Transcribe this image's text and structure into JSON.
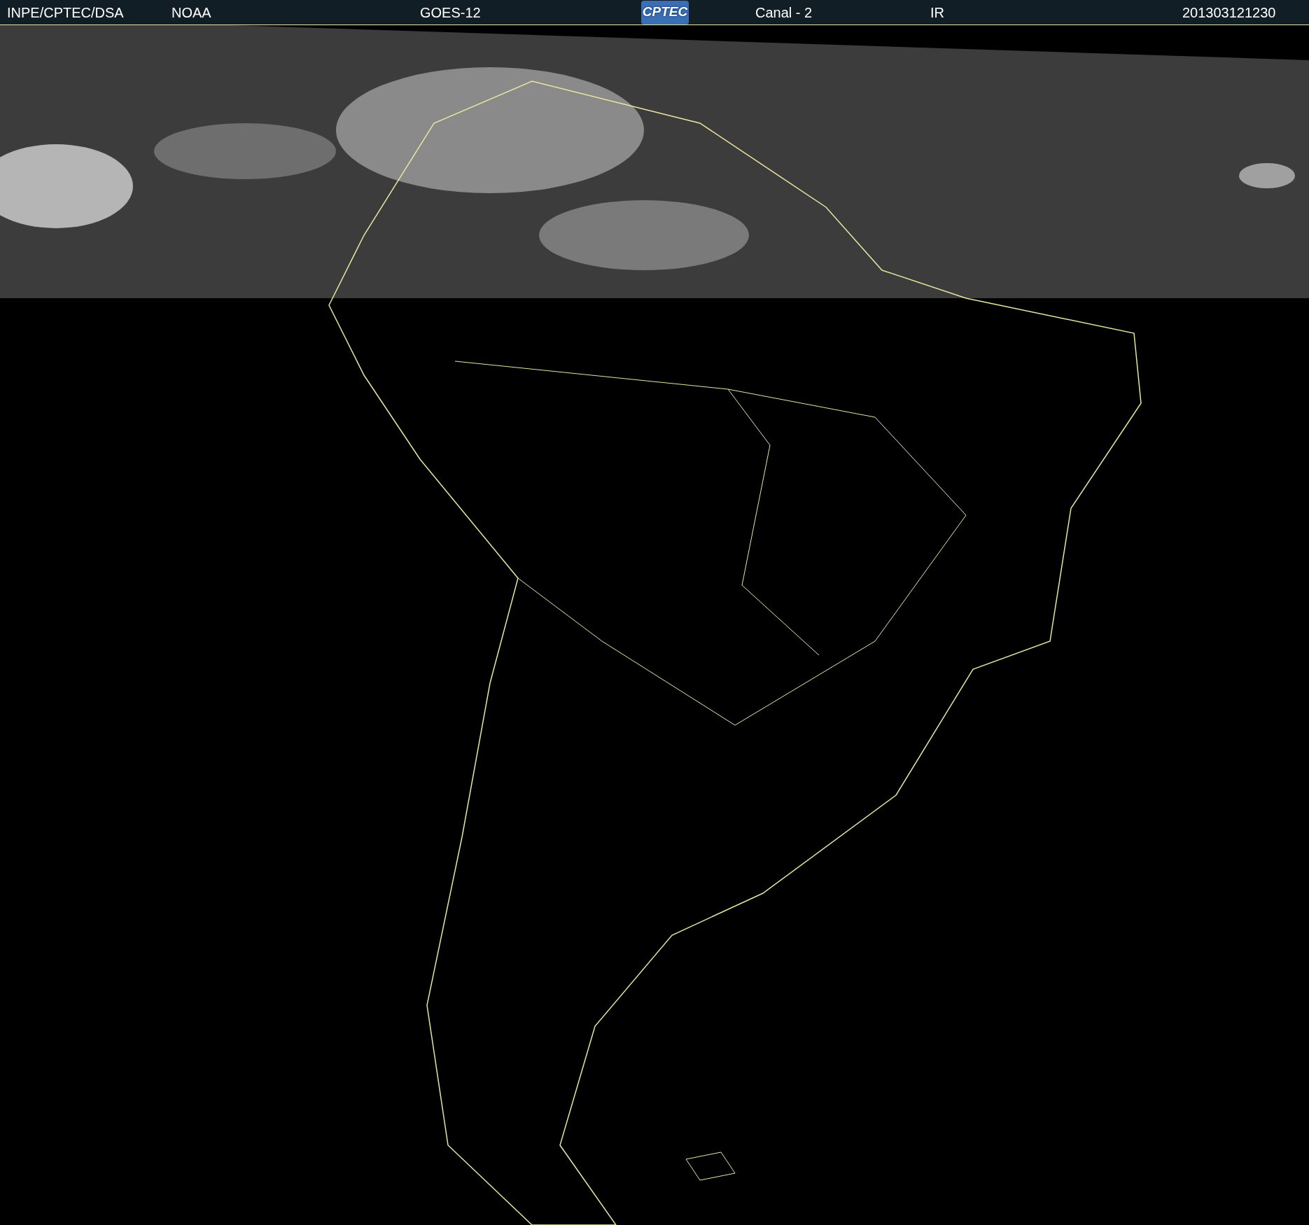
{
  "header": {
    "source": "INPE/CPTEC/DSA",
    "agency": "NOAA",
    "satellite": "GOES-12",
    "logo_text": "CPTEC",
    "channel": "Canal - 2",
    "band": "IR",
    "timestamp": "201303121230"
  }
}
